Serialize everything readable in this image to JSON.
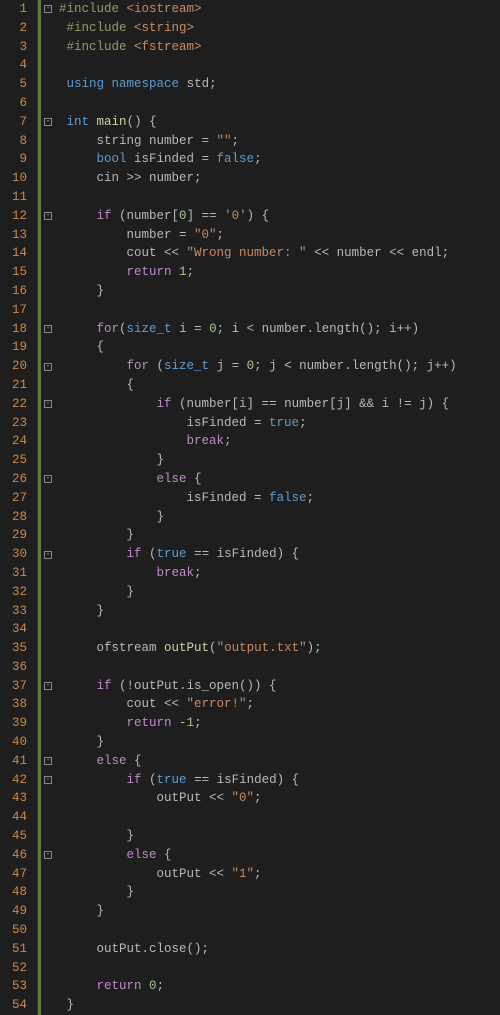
{
  "lines": [
    {
      "num": "1",
      "fold": "⊟",
      "tokens": [
        {
          "t": "#include ",
          "c": "tok-pre"
        },
        {
          "t": "<iostream>",
          "c": "tok-include"
        }
      ]
    },
    {
      "num": "2",
      "fold": "",
      "tokens": [
        {
          "t": " ",
          "c": ""
        },
        {
          "t": "#include ",
          "c": "tok-pre"
        },
        {
          "t": "<string>",
          "c": "tok-include"
        }
      ]
    },
    {
      "num": "3",
      "fold": "",
      "tokens": [
        {
          "t": " ",
          "c": ""
        },
        {
          "t": "#include ",
          "c": "tok-pre"
        },
        {
          "t": "<fstream>",
          "c": "tok-include"
        }
      ]
    },
    {
      "num": "4",
      "fold": "",
      "tokens": []
    },
    {
      "num": "5",
      "fold": "",
      "tokens": [
        {
          "t": " ",
          "c": ""
        },
        {
          "t": "using",
          "c": "tok-keyword"
        },
        {
          "t": " ",
          "c": ""
        },
        {
          "t": "namespace",
          "c": "tok-keyword"
        },
        {
          "t": " std;",
          "c": "tok-ident"
        }
      ]
    },
    {
      "num": "6",
      "fold": "",
      "tokens": []
    },
    {
      "num": "7",
      "fold": "⊟",
      "tokens": [
        {
          "t": " ",
          "c": ""
        },
        {
          "t": "int",
          "c": "tok-type"
        },
        {
          "t": " ",
          "c": ""
        },
        {
          "t": "main",
          "c": "tok-func"
        },
        {
          "t": "() {",
          "c": "tok-punc"
        }
      ]
    },
    {
      "num": "8",
      "fold": "",
      "tokens": [
        {
          "t": "     string number = ",
          "c": "tok-ident"
        },
        {
          "t": "\"\"",
          "c": "tok-string"
        },
        {
          "t": ";",
          "c": "tok-punc"
        }
      ]
    },
    {
      "num": "9",
      "fold": "",
      "tokens": [
        {
          "t": "     ",
          "c": ""
        },
        {
          "t": "bool",
          "c": "tok-type"
        },
        {
          "t": " isFinded = ",
          "c": "tok-ident"
        },
        {
          "t": "false",
          "c": "tok-bool"
        },
        {
          "t": ";",
          "c": "tok-punc"
        }
      ]
    },
    {
      "num": "10",
      "fold": "",
      "tokens": [
        {
          "t": "     cin >> number;",
          "c": "tok-ident"
        }
      ]
    },
    {
      "num": "11",
      "fold": "",
      "tokens": []
    },
    {
      "num": "12",
      "fold": "⊟",
      "tokens": [
        {
          "t": "     ",
          "c": ""
        },
        {
          "t": "if",
          "c": "tok-flow"
        },
        {
          "t": " (number[",
          "c": "tok-ident"
        },
        {
          "t": "0",
          "c": "tok-number"
        },
        {
          "t": "] == ",
          "c": "tok-ident"
        },
        {
          "t": "'0'",
          "c": "tok-string"
        },
        {
          "t": ") {",
          "c": "tok-punc"
        }
      ]
    },
    {
      "num": "13",
      "fold": "",
      "tokens": [
        {
          "t": "         number = ",
          "c": "tok-ident"
        },
        {
          "t": "\"0\"",
          "c": "tok-string"
        },
        {
          "t": ";",
          "c": "tok-punc"
        }
      ]
    },
    {
      "num": "14",
      "fold": "",
      "tokens": [
        {
          "t": "         cout << ",
          "c": "tok-ident"
        },
        {
          "t": "\"Wrong number: \"",
          "c": "tok-string"
        },
        {
          "t": " << number << endl;",
          "c": "tok-ident"
        }
      ]
    },
    {
      "num": "15",
      "fold": "",
      "tokens": [
        {
          "t": "         ",
          "c": ""
        },
        {
          "t": "return",
          "c": "tok-flow"
        },
        {
          "t": " ",
          "c": ""
        },
        {
          "t": "1",
          "c": "tok-number"
        },
        {
          "t": ";",
          "c": "tok-punc"
        }
      ]
    },
    {
      "num": "16",
      "fold": "",
      "tokens": [
        {
          "t": "     }",
          "c": "tok-punc"
        }
      ]
    },
    {
      "num": "17",
      "fold": "",
      "tokens": []
    },
    {
      "num": "18",
      "fold": "⊟",
      "tokens": [
        {
          "t": "     ",
          "c": ""
        },
        {
          "t": "for",
          "c": "tok-flow"
        },
        {
          "t": "(",
          "c": "tok-punc"
        },
        {
          "t": "size_t",
          "c": "tok-type"
        },
        {
          "t": " i = ",
          "c": "tok-ident"
        },
        {
          "t": "0",
          "c": "tok-number"
        },
        {
          "t": "; i < number.length(); i++)",
          "c": "tok-ident"
        }
      ]
    },
    {
      "num": "19",
      "fold": "",
      "tokens": [
        {
          "t": "     {",
          "c": "tok-punc"
        }
      ]
    },
    {
      "num": "20",
      "fold": "⊟",
      "tokens": [
        {
          "t": "         ",
          "c": ""
        },
        {
          "t": "for",
          "c": "tok-flow"
        },
        {
          "t": " (",
          "c": "tok-punc"
        },
        {
          "t": "size_t",
          "c": "tok-type"
        },
        {
          "t": " j = ",
          "c": "tok-ident"
        },
        {
          "t": "0",
          "c": "tok-number"
        },
        {
          "t": "; j < number.length(); j++)",
          "c": "tok-ident"
        }
      ]
    },
    {
      "num": "21",
      "fold": "",
      "tokens": [
        {
          "t": "         {",
          "c": "tok-punc"
        }
      ]
    },
    {
      "num": "22",
      "fold": "⊟",
      "tokens": [
        {
          "t": "             ",
          "c": ""
        },
        {
          "t": "if",
          "c": "tok-flow"
        },
        {
          "t": " (number[i] == number[j] && i != j) {",
          "c": "tok-ident"
        }
      ]
    },
    {
      "num": "23",
      "fold": "",
      "tokens": [
        {
          "t": "                 isFinded = ",
          "c": "tok-ident"
        },
        {
          "t": "true",
          "c": "tok-bool"
        },
        {
          "t": ";",
          "c": "tok-punc"
        }
      ]
    },
    {
      "num": "24",
      "fold": "",
      "tokens": [
        {
          "t": "                 ",
          "c": ""
        },
        {
          "t": "break",
          "c": "tok-flow"
        },
        {
          "t": ";",
          "c": "tok-punc"
        }
      ]
    },
    {
      "num": "25",
      "fold": "",
      "tokens": [
        {
          "t": "             }",
          "c": "tok-punc"
        }
      ]
    },
    {
      "num": "26",
      "fold": "⊟",
      "tokens": [
        {
          "t": "             ",
          "c": ""
        },
        {
          "t": "else",
          "c": "tok-flow"
        },
        {
          "t": " {",
          "c": "tok-punc"
        }
      ]
    },
    {
      "num": "27",
      "fold": "",
      "tokens": [
        {
          "t": "                 isFinded = ",
          "c": "tok-ident"
        },
        {
          "t": "false",
          "c": "tok-bool"
        },
        {
          "t": ";",
          "c": "tok-punc"
        }
      ]
    },
    {
      "num": "28",
      "fold": "",
      "tokens": [
        {
          "t": "             }",
          "c": "tok-punc"
        }
      ]
    },
    {
      "num": "29",
      "fold": "",
      "tokens": [
        {
          "t": "         }",
          "c": "tok-punc"
        }
      ]
    },
    {
      "num": "30",
      "fold": "⊟",
      "tokens": [
        {
          "t": "         ",
          "c": ""
        },
        {
          "t": "if",
          "c": "tok-flow"
        },
        {
          "t": " (",
          "c": "tok-punc"
        },
        {
          "t": "true",
          "c": "tok-bool"
        },
        {
          "t": " == isFinded) {",
          "c": "tok-ident"
        }
      ]
    },
    {
      "num": "31",
      "fold": "",
      "tokens": [
        {
          "t": "             ",
          "c": ""
        },
        {
          "t": "break",
          "c": "tok-flow"
        },
        {
          "t": ";",
          "c": "tok-punc"
        }
      ]
    },
    {
      "num": "32",
      "fold": "",
      "tokens": [
        {
          "t": "         }",
          "c": "tok-punc"
        }
      ]
    },
    {
      "num": "33",
      "fold": "",
      "tokens": [
        {
          "t": "     }",
          "c": "tok-punc"
        }
      ]
    },
    {
      "num": "34",
      "fold": "",
      "tokens": []
    },
    {
      "num": "35",
      "fold": "",
      "tokens": [
        {
          "t": "     ofstream ",
          "c": "tok-ident"
        },
        {
          "t": "outPut",
          "c": "tok-func"
        },
        {
          "t": "(",
          "c": "tok-punc"
        },
        {
          "t": "\"output.txt\"",
          "c": "tok-string"
        },
        {
          "t": ");",
          "c": "tok-punc"
        }
      ]
    },
    {
      "num": "36",
      "fold": "",
      "tokens": []
    },
    {
      "num": "37",
      "fold": "⊟",
      "tokens": [
        {
          "t": "     ",
          "c": ""
        },
        {
          "t": "if",
          "c": "tok-flow"
        },
        {
          "t": " (!outPut.is_open()) {",
          "c": "tok-ident"
        }
      ]
    },
    {
      "num": "38",
      "fold": "",
      "tokens": [
        {
          "t": "         cout << ",
          "c": "tok-ident"
        },
        {
          "t": "\"error!\"",
          "c": "tok-string"
        },
        {
          "t": ";",
          "c": "tok-punc"
        }
      ]
    },
    {
      "num": "39",
      "fold": "",
      "tokens": [
        {
          "t": "         ",
          "c": ""
        },
        {
          "t": "return",
          "c": "tok-flow"
        },
        {
          "t": " -",
          "c": "tok-ident"
        },
        {
          "t": "1",
          "c": "tok-number"
        },
        {
          "t": ";",
          "c": "tok-punc"
        }
      ]
    },
    {
      "num": "40",
      "fold": "",
      "tokens": [
        {
          "t": "     }",
          "c": "tok-punc"
        }
      ]
    },
    {
      "num": "41",
      "fold": "⊟",
      "tokens": [
        {
          "t": "     ",
          "c": ""
        },
        {
          "t": "else",
          "c": "tok-flow"
        },
        {
          "t": " {",
          "c": "tok-punc"
        }
      ]
    },
    {
      "num": "42",
      "fold": "⊟",
      "tokens": [
        {
          "t": "         ",
          "c": ""
        },
        {
          "t": "if",
          "c": "tok-flow"
        },
        {
          "t": " (",
          "c": "tok-punc"
        },
        {
          "t": "true",
          "c": "tok-bool"
        },
        {
          "t": " == isFinded) {",
          "c": "tok-ident"
        }
      ]
    },
    {
      "num": "43",
      "fold": "",
      "tokens": [
        {
          "t": "             outPut << ",
          "c": "tok-ident"
        },
        {
          "t": "\"0\"",
          "c": "tok-string"
        },
        {
          "t": ";",
          "c": "tok-punc"
        }
      ]
    },
    {
      "num": "44",
      "fold": "",
      "tokens": []
    },
    {
      "num": "45",
      "fold": "",
      "tokens": [
        {
          "t": "         }",
          "c": "tok-punc"
        }
      ]
    },
    {
      "num": "46",
      "fold": "⊟",
      "tokens": [
        {
          "t": "         ",
          "c": ""
        },
        {
          "t": "else",
          "c": "tok-flow"
        },
        {
          "t": " {",
          "c": "tok-punc"
        }
      ]
    },
    {
      "num": "47",
      "fold": "",
      "tokens": [
        {
          "t": "             outPut << ",
          "c": "tok-ident"
        },
        {
          "t": "\"1\"",
          "c": "tok-string"
        },
        {
          "t": ";",
          "c": "tok-punc"
        }
      ]
    },
    {
      "num": "48",
      "fold": "",
      "tokens": [
        {
          "t": "         }",
          "c": "tok-punc"
        }
      ]
    },
    {
      "num": "49",
      "fold": "",
      "tokens": [
        {
          "t": "     }",
          "c": "tok-punc"
        }
      ]
    },
    {
      "num": "50",
      "fold": "",
      "tokens": []
    },
    {
      "num": "51",
      "fold": "",
      "tokens": [
        {
          "t": "     outPut.close();",
          "c": "tok-ident"
        }
      ]
    },
    {
      "num": "52",
      "fold": "",
      "tokens": []
    },
    {
      "num": "53",
      "fold": "",
      "tokens": [
        {
          "t": "     ",
          "c": ""
        },
        {
          "t": "return",
          "c": "tok-flow"
        },
        {
          "t": " ",
          "c": ""
        },
        {
          "t": "0",
          "c": "tok-number"
        },
        {
          "t": ";",
          "c": "tok-punc"
        }
      ]
    },
    {
      "num": "54",
      "fold": "",
      "tokens": [
        {
          "t": " }",
          "c": "tok-punc"
        }
      ]
    }
  ]
}
